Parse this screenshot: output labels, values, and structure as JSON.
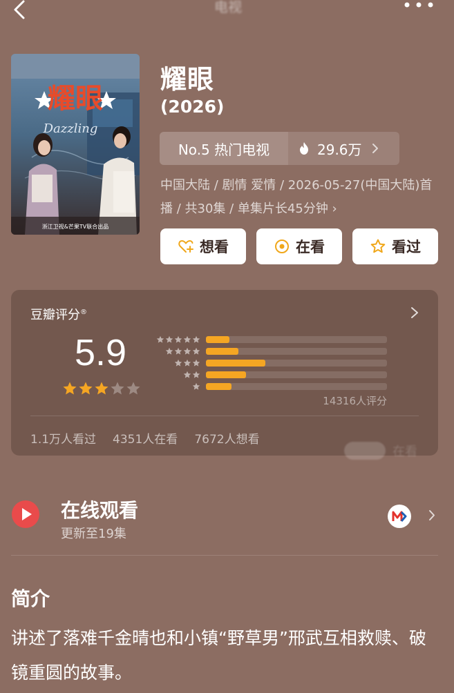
{
  "header": {
    "title": "电视"
  },
  "movie": {
    "title": "耀眼",
    "year": "(2026)",
    "poster": {
      "title_art": "耀眼",
      "english_art": "Dazzling",
      "caption": "浙江卫视&芒果TV联合出品"
    },
    "rank_label": "No.5 热门电视",
    "heat": "29.6万",
    "meta": "中国大陆 / 剧情 爱情 / 2026-05-27(中国大陆)首播 / 共30集 / 单集片长45分钟 ›"
  },
  "actions": [
    {
      "label": "想看",
      "icon": "heart-plus-icon"
    },
    {
      "label": "在看",
      "icon": "watching-icon"
    },
    {
      "label": "看过",
      "icon": "star-outline-icon"
    }
  ],
  "rating": {
    "label": "豆瓣评分",
    "registered": "®",
    "score": "5.9",
    "stars_filled": 3,
    "stars_total": 5,
    "distribution": [
      {
        "stars": 5,
        "fraction": 0.13
      },
      {
        "stars": 4,
        "fraction": 0.18
      },
      {
        "stars": 3,
        "fraction": 0.33
      },
      {
        "stars": 2,
        "fraction": 0.22
      },
      {
        "stars": 1,
        "fraction": 0.14
      }
    ],
    "votes": "14316人评分",
    "stats": [
      "1.1万人看过",
      "4351人在看",
      "7672人想看"
    ],
    "watermark": "在看"
  },
  "online": {
    "title": "在线观看",
    "subtitle": "更新至19集"
  },
  "intro": {
    "title": "简介",
    "text": "讲述了落难千金晴也和小镇“野草男”邢武互相救赎、破镜重圆的故事。"
  },
  "colors": {
    "background": "#8c6d62",
    "card": "#73584e",
    "accent": "#f5a623",
    "play_red": "#e94b4b"
  }
}
